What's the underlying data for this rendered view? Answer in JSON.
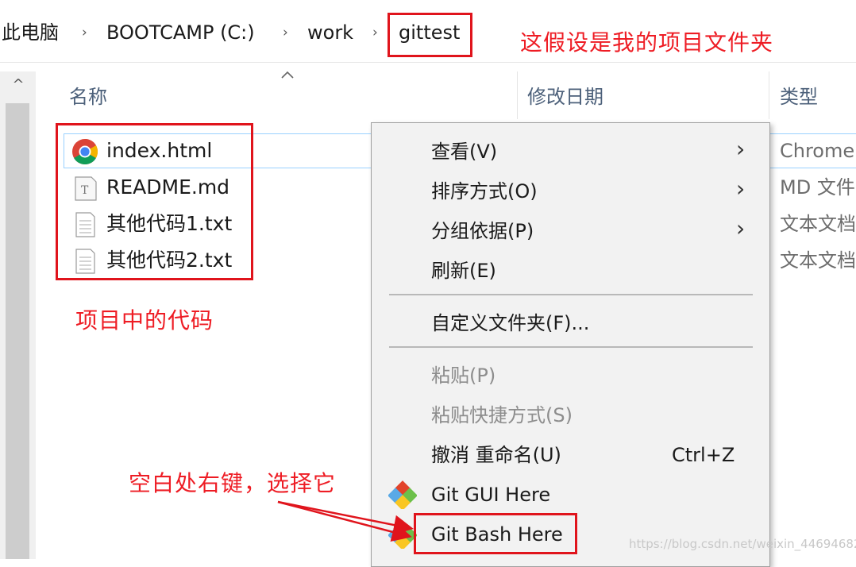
{
  "breadcrumb": [
    "此电脑",
    "BOOTCAMP (C:)",
    "work",
    "gittest"
  ],
  "breadcrumb_sep": "›",
  "annotations": {
    "folder_note": "这假设是我的项目文件夹",
    "code_note": "项目中的代码",
    "rightclick_note": "空白处右键，选择它"
  },
  "columns": {
    "name": "名称",
    "modified": "修改日期",
    "type": "类型"
  },
  "files": [
    {
      "name": "index.html",
      "type": "Chrome",
      "icon": "chrome-icon"
    },
    {
      "name": "README.md",
      "type": "MD 文件",
      "icon": "text-file-icon"
    },
    {
      "name": "其他代码1.txt",
      "type": "文本文档",
      "icon": "document-icon"
    },
    {
      "name": "其他代码2.txt",
      "type": "文本文档",
      "icon": "document-icon"
    }
  ],
  "context_menu": {
    "view": "查看(V)",
    "sort": "排序方式(O)",
    "group": "分组依据(P)",
    "refresh": "刷新(E)",
    "customize": "自定义文件夹(F)...",
    "paste": "粘贴(P)",
    "paste_shortcut": "粘贴快捷方式(S)",
    "undo_rename": "撤消 重命名(U)",
    "undo_shortcut": "Ctrl+Z",
    "git_gui": "Git GUI Here",
    "git_bash": "Git Bash Here",
    "submenu_arrow": "›"
  },
  "scroll_up": "^",
  "watermark": "https://blog.csdn.net/weixin_44694682",
  "colors": {
    "annotation_red": "#e0141c",
    "selection_border": "#99d1ff",
    "menu_bg": "#f2f2f2"
  }
}
